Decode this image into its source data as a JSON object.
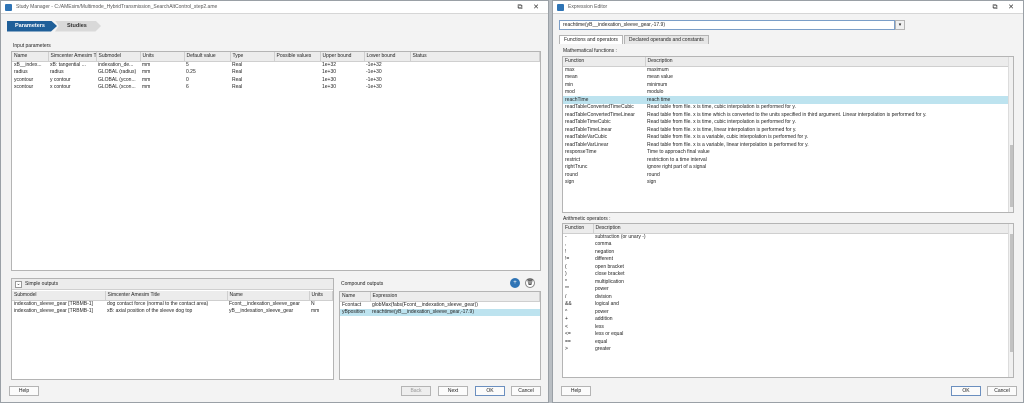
{
  "study_manager": {
    "title": "Study Manager - C:/AMEsim/Multimode_HybridTransmission_SearchAltControl_step2.ame",
    "steps": [
      "Parameters",
      "Studies"
    ],
    "input_parameters_label": "Input parameters",
    "input_columns": [
      "Name",
      "Simcenter Amesim Title",
      "Submodel",
      "Units",
      "Default value",
      "Type",
      "Possible values",
      "Upper bound",
      "Lower bound",
      "Status"
    ],
    "input_rows": [
      [
        "xB__index...",
        "xB: tangential ...",
        "indexation_de...",
        "mm",
        "5",
        "Real",
        "",
        "1e+32",
        "-1e+32",
        ""
      ],
      [
        "radius",
        "radius",
        "GLOBAL (radius)",
        "mm",
        "0.25",
        "Real",
        "",
        "1e+30",
        "-1e+30",
        ""
      ],
      [
        "ycontour",
        "y contour",
        "GLOBAL (ycon...",
        "mm",
        "0",
        "Real",
        "",
        "1e+30",
        "-1e+30",
        ""
      ],
      [
        "xcontour",
        "x contour",
        "GLOBAL (xcon...",
        "mm",
        "6",
        "Real",
        "",
        "1e+30",
        "-1e+30",
        ""
      ]
    ],
    "simple_outputs_label": "Simple outputs",
    "simple_columns": [
      "Submodel",
      "Simcenter Amesim Title",
      "Name",
      "Units"
    ],
    "simple_rows": [
      [
        "indexation_sleeve_gear [TRBMB-1]",
        "dog contact force (normal to the contact area)",
        "Fcont__indexation_sleeve_gear",
        "N"
      ],
      [
        "indexation_sleeve_gear [TRBMB-1]",
        "xB: axial position of the sleeve dog top",
        "yB__indexation_sleeve_gear",
        "mm"
      ]
    ],
    "compound_outputs_label": "Compound outputs",
    "compound_columns": [
      "Name",
      "Expression"
    ],
    "compound_rows": [
      [
        "Fcontact",
        "globMax(fabs(Fcont__indexation_sleeve_gear))"
      ],
      [
        "yBposition",
        "reachtime(yB__indexation_sleeve_gear,-17.9)"
      ]
    ],
    "buttons": {
      "help": "Help",
      "back": "Back",
      "next": "Next",
      "ok": "OK",
      "cancel": "Cancel"
    }
  },
  "expression_editor": {
    "title": "Expression Editor",
    "expression": "reachtime(yB__indexation_sleeve_gear,-17.9)",
    "tabs": [
      "Functions and operators",
      "Declared operands and constants"
    ],
    "math_label": "Mathematical functions :",
    "math_columns": [
      "Function",
      "Description"
    ],
    "math_rows": [
      [
        "max",
        "maximum"
      ],
      [
        "mean",
        "mean value"
      ],
      [
        "min",
        "minimum"
      ],
      [
        "mod",
        "modulo"
      ],
      [
        "reachTime",
        "reach time"
      ],
      [
        "readTableConvertedTimeCubic",
        "Read table from file. x is time, cubic interpolation is performed for y."
      ],
      [
        "readTableConvertedTimeLinear",
        "Read table from file. x is time which is converted to the units specified in third argument. Linear interpolation is performed for y."
      ],
      [
        "readTableTimeCubic",
        "Read table from file. x is time, cubic interpolation is performed for y."
      ],
      [
        "readTableTimeLinear",
        "Read table from file. x is time, linear interpolation is performed for y."
      ],
      [
        "readTableVarCubic",
        "Read table from file. x is a variable, cubic interpolation is performed for y."
      ],
      [
        "readTableVarLinear",
        "Read table from file. x is a variable, linear interpolation is performed for y."
      ],
      [
        "responseTime",
        "Time to approach final value"
      ],
      [
        "restrict",
        "restriction to a time interval"
      ],
      [
        "rightTrunc",
        "ignore right part of a signal"
      ],
      [
        "round",
        "round"
      ],
      [
        "sign",
        "sign"
      ]
    ],
    "arith_label": "Arithmetic operators :",
    "arith_columns": [
      "Function",
      "Description"
    ],
    "arith_rows": [
      [
        "-",
        "subtraction (or unary -)"
      ],
      [
        ",",
        "comma"
      ],
      [
        "!",
        "negation"
      ],
      [
        "!=",
        "different"
      ],
      [
        "(",
        "open bracket"
      ],
      [
        ")",
        "close bracket"
      ],
      [
        "*",
        "multiplication"
      ],
      [
        "**",
        "power"
      ],
      [
        "/",
        "division"
      ],
      [
        "&&",
        "logical and"
      ],
      [
        "^",
        "power"
      ],
      [
        "+",
        "addition"
      ],
      [
        "<",
        "less"
      ],
      [
        "<=",
        "less or equal"
      ],
      [
        "==",
        "equal"
      ],
      [
        ">",
        "greater"
      ]
    ],
    "buttons": {
      "help": "Help",
      "ok": "OK",
      "cancel": "Cancel"
    }
  },
  "colors": {
    "accent": "#1f5f99",
    "selection": "#bde3ef"
  }
}
